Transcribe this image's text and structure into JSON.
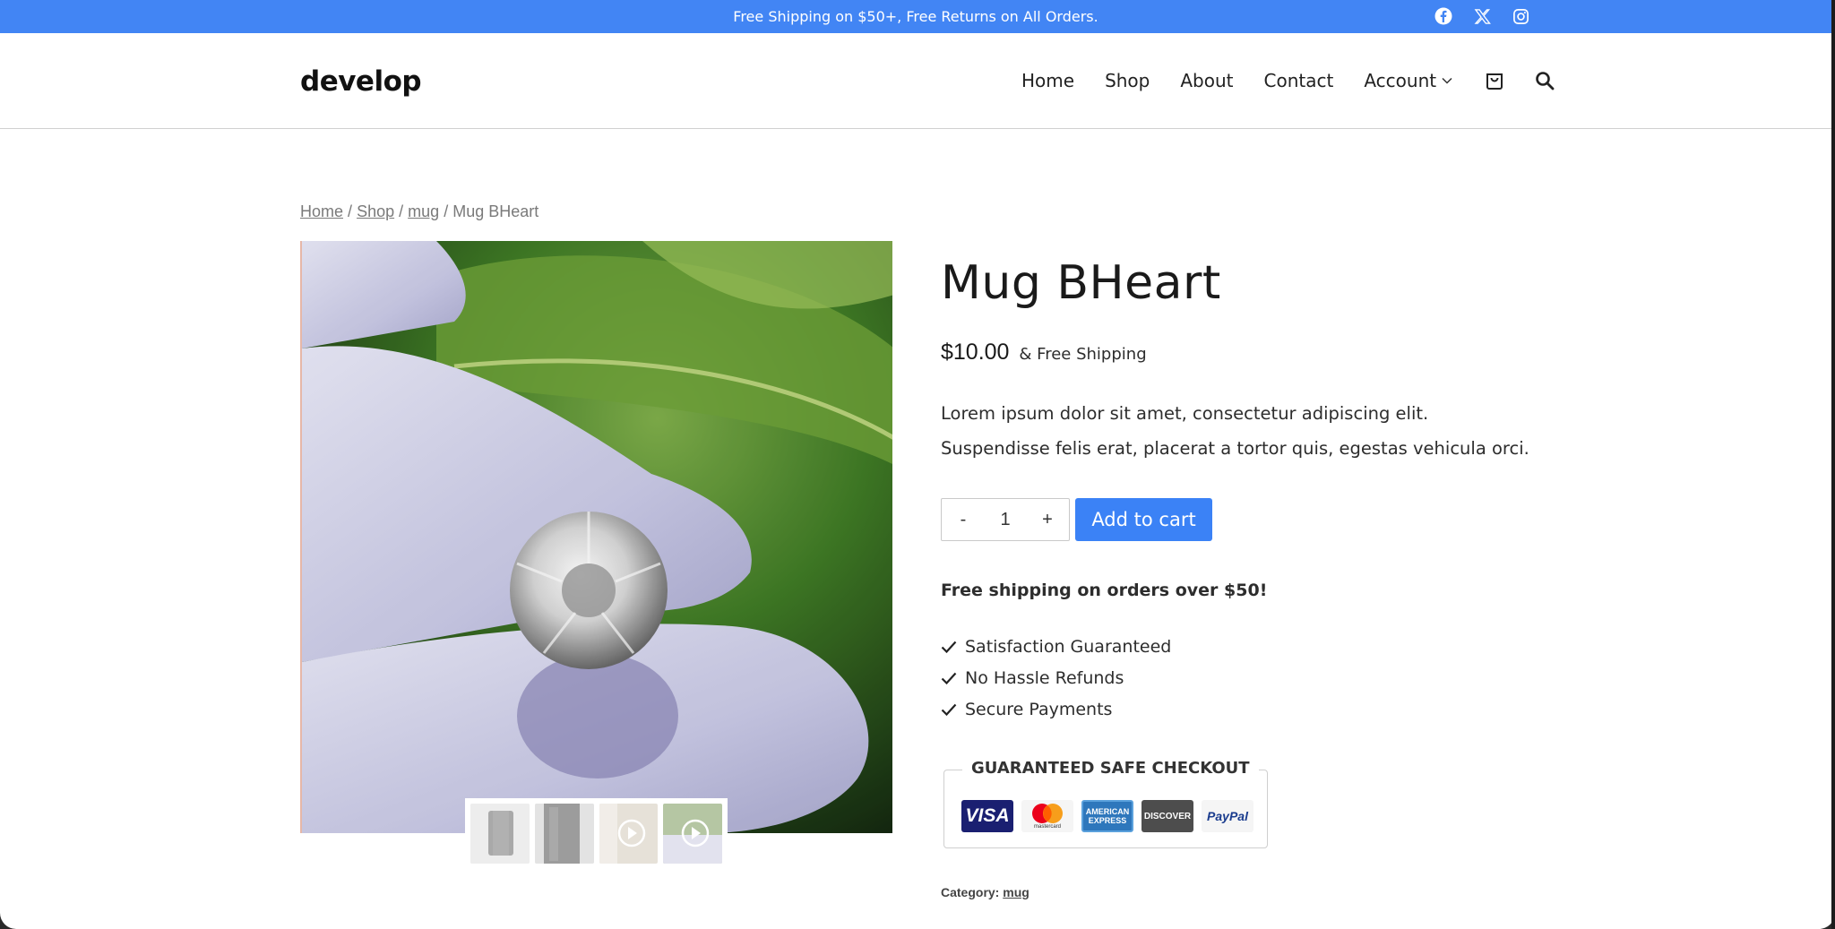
{
  "topbar": {
    "message": "Free Shipping on $50+, Free Returns on All Orders.",
    "social_icons": [
      "facebook-icon",
      "x-twitter-icon",
      "instagram-icon"
    ]
  },
  "header": {
    "logo": "develop",
    "nav": [
      {
        "label": "Home"
      },
      {
        "label": "Shop"
      },
      {
        "label": "About"
      },
      {
        "label": "Contact"
      },
      {
        "label": "Account"
      }
    ],
    "icons": [
      "cart-icon",
      "search-icon"
    ]
  },
  "breadcrumb": {
    "items": [
      "Home",
      "Shop",
      "mug"
    ],
    "current": "Mug BHeart",
    "separator": "/"
  },
  "product": {
    "title": "Mug BHeart",
    "price": "$10.00",
    "shipping_suffix": "& Free Shipping",
    "description": "Lorem ipsum dolor sit amet, consectetur adipiscing elit. Suspendisse felis erat, placerat a tortor quis, egestas vehicula orci.",
    "quantity": "1",
    "minus_label": "-",
    "plus_label": "+",
    "add_to_cart_label": "Add to cart",
    "shipping_note": "Free shipping on orders over $50!",
    "features": [
      "Satisfaction Guaranteed",
      "No Hassle Refunds",
      "Secure Payments"
    ],
    "checkout_title": "GUARANTEED SAFE CHECKOUT",
    "payment_methods": [
      "VISA",
      "mastercard",
      "AMERICAN EXPRESS",
      "DISCOVER",
      "PayPal"
    ],
    "category_label": "Category:",
    "category_value": "mug"
  },
  "colors": {
    "topbar_bg": "#4285f4",
    "button_bg": "#3b82f6"
  }
}
